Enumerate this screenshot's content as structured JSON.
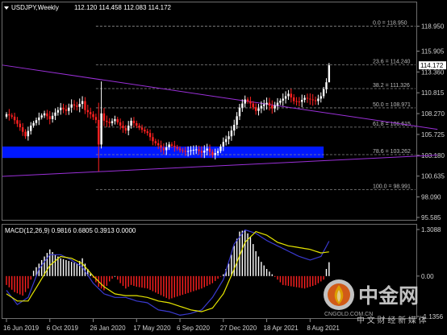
{
  "header": {
    "symbol": "USDJPY,Weekly",
    "ohlc": "112.120 114.458 112.083 114.172"
  },
  "colors": {
    "background": "#000000",
    "bull": "#ffffff",
    "bear": "#ff2020",
    "fib": "#8a8a8a",
    "trendline": "#9b30d9",
    "zone": "#0018ff",
    "macd_signal": "#e6e600",
    "macd_line": "#3a3ad0",
    "price_label_bg": "#ffffff"
  },
  "price_label": "114.172",
  "fib_levels": [
    {
      "label": "0.0 = 118.950",
      "price": 118.95
    },
    {
      "label": "23.6 = 114.240",
      "price": 114.24
    },
    {
      "label": "38.2 = 111.326",
      "price": 111.326
    },
    {
      "label": "50.0 = 108.971",
      "price": 108.971
    },
    {
      "label": "61.8 = 106.615",
      "price": 106.615
    },
    {
      "label": "78.6 = 103.262",
      "price": 103.262
    },
    {
      "label": "100.0 = 98.991",
      "price": 98.991
    }
  ],
  "zone": {
    "low": 102.85,
    "high": 104.25
  },
  "trendlines": [
    {
      "from": [
        0,
        114.2
      ],
      "to": [
        159,
        106.35
      ]
    },
    {
      "from": [
        0,
        100.6
      ],
      "to": [
        159,
        103.2
      ]
    }
  ],
  "chart_data": [
    {
      "type": "candlestick",
      "title": "USDJPY,Weekly",
      "ylim": [
        95.585,
        119.2
      ],
      "yticks": [
        "118.950",
        "115.905",
        "113.360",
        "110.815",
        "108.270",
        "105.725",
        "103.180",
        "100.635",
        "98.090",
        "95.585"
      ],
      "x_labels": [
        {
          "label": "16 Jun 2019",
          "index": 0
        },
        {
          "label": "6 Oct 2019",
          "index": 16
        },
        {
          "label": "26 Jan 2020",
          "index": 32
        },
        {
          "label": "17 May 2020",
          "index": 48
        },
        {
          "label": "6 Sep 2020",
          "index": 64
        },
        {
          "label": "27 Dec 2020",
          "index": 80
        },
        {
          "label": "18 Apr 2021",
          "index": 96
        },
        {
          "label": "8 Aug 2021",
          "index": 112
        }
      ],
      "anchors": [
        [
          0,
          108.2
        ],
        [
          2,
          107.9
        ],
        [
          5,
          106.6
        ],
        [
          7,
          105.5
        ],
        [
          9,
          106.8
        ],
        [
          12,
          107.8
        ],
        [
          14,
          108.3
        ],
        [
          16,
          107.6
        ],
        [
          18,
          108.4
        ],
        [
          20,
          109.0
        ],
        [
          22,
          108.6
        ],
        [
          24,
          109.4
        ],
        [
          26,
          109.1
        ],
        [
          28,
          109.8
        ],
        [
          29,
          108.7
        ],
        [
          31,
          108.2
        ],
        [
          33,
          107.5
        ],
        [
          34,
          104.5
        ],
        [
          35,
          108.3
        ],
        [
          36,
          107.4
        ],
        [
          38,
          107.1
        ],
        [
          40,
          107.6
        ],
        [
          42,
          106.8
        ],
        [
          44,
          106.2
        ],
        [
          46,
          107.4
        ],
        [
          48,
          106.8
        ],
        [
          50,
          106.3
        ],
        [
          52,
          105.9
        ],
        [
          54,
          104.9
        ],
        [
          56,
          104.4
        ],
        [
          58,
          103.8
        ],
        [
          60,
          104.5
        ],
        [
          62,
          104.2
        ],
        [
          64,
          103.8
        ],
        [
          66,
          103.6
        ],
        [
          68,
          103.8
        ],
        [
          70,
          103.9
        ],
        [
          72,
          103.5
        ],
        [
          74,
          104.0
        ],
        [
          76,
          103.2
        ],
        [
          78,
          103.7
        ],
        [
          80,
          104.8
        ],
        [
          82,
          105.5
        ],
        [
          84,
          106.9
        ],
        [
          86,
          109.0
        ],
        [
          88,
          110.0
        ],
        [
          90,
          109.5
        ],
        [
          92,
          108.6
        ],
        [
          94,
          109.2
        ],
        [
          96,
          109.6
        ],
        [
          98,
          108.9
        ],
        [
          100,
          109.6
        ],
        [
          102,
          110.1
        ],
        [
          104,
          110.7
        ],
        [
          106,
          109.8
        ],
        [
          108,
          109.7
        ],
        [
          110,
          110.2
        ],
        [
          112,
          110.0
        ],
        [
          114,
          109.8
        ],
        [
          116,
          110.4
        ],
        [
          118,
          112.1
        ],
        [
          119,
          114.17
        ]
      ],
      "candle_count": 120
    },
    {
      "type": "macd",
      "title": "MACD(12,26,9) 0.9816 0.6805 0.3913 0.0000",
      "ylim": [
        -1.1356,
        1.3088
      ],
      "yticks": [
        "1.3088",
        "0.00",
        "-1.1356"
      ],
      "histogram_anchors": [
        [
          0,
          -0.25
        ],
        [
          3,
          -0.45
        ],
        [
          6,
          -0.55
        ],
        [
          8,
          -0.35
        ],
        [
          10,
          0.15
        ],
        [
          12,
          0.35
        ],
        [
          14,
          0.55
        ],
        [
          16,
          0.75
        ],
        [
          18,
          0.6
        ],
        [
          20,
          0.5
        ],
        [
          22,
          0.45
        ],
        [
          24,
          0.4
        ],
        [
          26,
          0.35
        ],
        [
          28,
          0.5
        ],
        [
          30,
          0.2
        ],
        [
          32,
          -0.05
        ],
        [
          34,
          -0.3
        ],
        [
          36,
          -0.4
        ],
        [
          38,
          -0.15
        ],
        [
          40,
          0.0
        ],
        [
          42,
          -0.2
        ],
        [
          44,
          -0.35
        ],
        [
          46,
          -0.25
        ],
        [
          48,
          -0.3
        ],
        [
          52,
          -0.35
        ],
        [
          56,
          -0.5
        ],
        [
          60,
          -0.65
        ],
        [
          64,
          -0.55
        ],
        [
          68,
          -0.45
        ],
        [
          72,
          -0.35
        ],
        [
          76,
          -0.2
        ],
        [
          80,
          0.05
        ],
        [
          82,
          0.35
        ],
        [
          84,
          0.85
        ],
        [
          86,
          1.25
        ],
        [
          88,
          1.3
        ],
        [
          90,
          1.1
        ],
        [
          92,
          0.7
        ],
        [
          94,
          0.4
        ],
        [
          96,
          0.2
        ],
        [
          98,
          0.05
        ],
        [
          100,
          -0.1
        ],
        [
          102,
          -0.25
        ],
        [
          106,
          -0.3
        ],
        [
          110,
          -0.35
        ],
        [
          114,
          -0.25
        ],
        [
          117,
          -0.1
        ],
        [
          118,
          0.2
        ],
        [
          119,
          0.39
        ]
      ],
      "signal_anchors": [
        [
          0,
          -0.5
        ],
        [
          4,
          -0.7
        ],
        [
          8,
          -0.7
        ],
        [
          12,
          -0.2
        ],
        [
          16,
          0.3
        ],
        [
          20,
          0.55
        ],
        [
          24,
          0.5
        ],
        [
          28,
          0.35
        ],
        [
          32,
          0.0
        ],
        [
          36,
          -0.3
        ],
        [
          40,
          -0.5
        ],
        [
          44,
          -0.55
        ],
        [
          48,
          -0.55
        ],
        [
          52,
          -0.6
        ],
        [
          56,
          -0.7
        ],
        [
          60,
          -0.75
        ],
        [
          64,
          -0.85
        ],
        [
          68,
          -0.95
        ],
        [
          72,
          -1.0
        ],
        [
          76,
          -0.9
        ],
        [
          80,
          -0.5
        ],
        [
          84,
          0.2
        ],
        [
          88,
          0.95
        ],
        [
          92,
          1.25
        ],
        [
          96,
          1.15
        ],
        [
          100,
          0.95
        ],
        [
          104,
          0.85
        ],
        [
          108,
          0.8
        ],
        [
          112,
          0.75
        ],
        [
          116,
          0.65
        ],
        [
          119,
          0.68
        ]
      ],
      "main_anchors": [
        [
          0,
          -0.4
        ],
        [
          4,
          -0.8
        ],
        [
          8,
          -0.6
        ],
        [
          12,
          0.2
        ],
        [
          16,
          0.6
        ],
        [
          20,
          0.6
        ],
        [
          24,
          0.45
        ],
        [
          28,
          0.25
        ],
        [
          32,
          -0.2
        ],
        [
          36,
          -0.5
        ],
        [
          40,
          -0.6
        ],
        [
          44,
          -0.6
        ],
        [
          48,
          -0.7
        ],
        [
          52,
          -0.75
        ],
        [
          56,
          -0.95
        ],
        [
          60,
          -1.0
        ],
        [
          64,
          -1.1
        ],
        [
          68,
          -1.05
        ],
        [
          72,
          -0.95
        ],
        [
          76,
          -0.6
        ],
        [
          80,
          -0.1
        ],
        [
          84,
          0.9
        ],
        [
          88,
          1.3
        ],
        [
          92,
          1.2
        ],
        [
          96,
          1.0
        ],
        [
          100,
          0.85
        ],
        [
          104,
          0.7
        ],
        [
          108,
          0.55
        ],
        [
          112,
          0.45
        ],
        [
          116,
          0.55
        ],
        [
          119,
          0.98
        ]
      ]
    }
  ],
  "watermark": {
    "brand_cn": "中金网",
    "domain": "CNGOLD.COM.CN",
    "slogan": "中 文 财 经 新 媒 体"
  }
}
